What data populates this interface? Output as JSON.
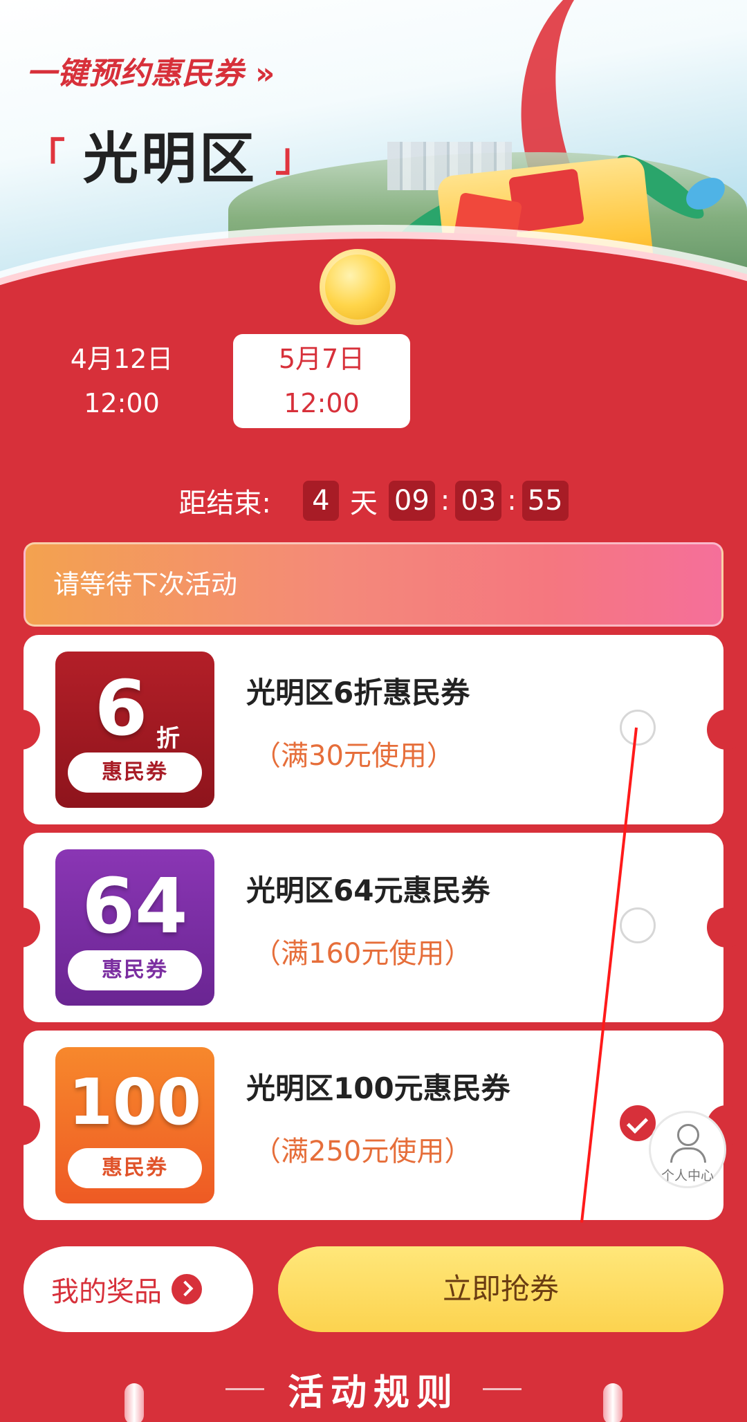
{
  "banner": {
    "title": "一键预约惠民券",
    "arrows": "»",
    "bracket_open": "「",
    "district": "光明区",
    "bracket_close": "」"
  },
  "dates": [
    {
      "day": "4月12日",
      "time": "12:00",
      "active": false
    },
    {
      "day": "5月7日",
      "time": "12:00",
      "active": true
    }
  ],
  "countdown": {
    "label": "距结束:",
    "days": "4",
    "days_unit": "天",
    "hours": "09",
    "minutes": "03",
    "seconds": "55",
    "separator": ":"
  },
  "status": {
    "text": "请等待下次活动"
  },
  "coupons": [
    {
      "badge_value": "6",
      "badge_unit": "折",
      "badge_label": "惠民券",
      "title": "光明区6折惠民券",
      "condition": "（满30元使用）",
      "checked": false,
      "badge_color": "#a81c26"
    },
    {
      "badge_value": "64",
      "badge_label": "惠民券",
      "title": "光明区64元惠民券",
      "condition": "（满160元使用）",
      "checked": false,
      "badge_color": "#7b2ea0"
    },
    {
      "badge_value": "100",
      "badge_label": "惠民券",
      "title": "光明区100元惠民券",
      "condition": "（满250元使用）",
      "checked": true,
      "badge_color": "#f26a2a"
    }
  ],
  "personal_center": {
    "label": "个人中心",
    "icon": "user-icon"
  },
  "buttons": {
    "my_prizes": "我的奖品",
    "grab": "立即抢券"
  },
  "rules": {
    "title": "活动规则"
  },
  "colors": {
    "primary": "#d7303a",
    "grab_button": "#fcd34f",
    "condition_text": "#e66e3a"
  }
}
